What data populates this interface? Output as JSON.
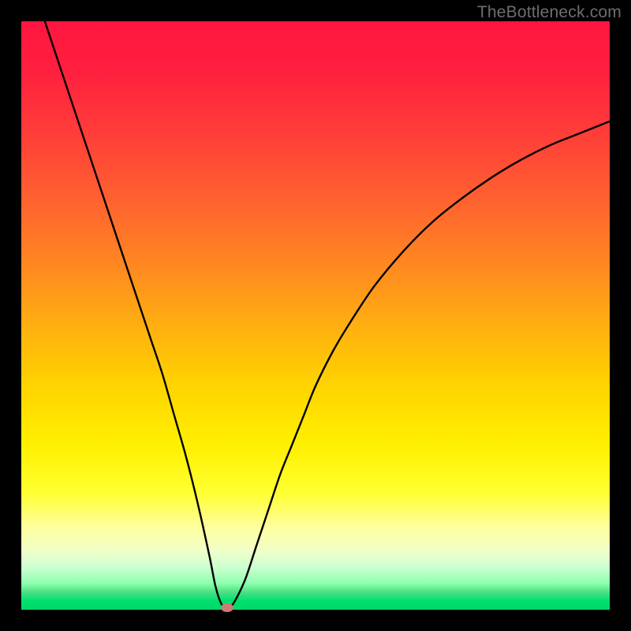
{
  "watermark": "TheBottleneck.com",
  "chart_data": {
    "type": "line",
    "title": "",
    "xlabel": "",
    "ylabel": "",
    "xlim": [
      0,
      100
    ],
    "ylim": [
      0,
      100
    ],
    "series": [
      {
        "name": "bottleneck-curve",
        "x": [
          4,
          6,
          8,
          10,
          12,
          14,
          16,
          18,
          20,
          22,
          24,
          26,
          28,
          30,
          32,
          33,
          34,
          35,
          36,
          38,
          40,
          42,
          44,
          46,
          48,
          50,
          53,
          56,
          60,
          65,
          70,
          75,
          80,
          85,
          90,
          95,
          100
        ],
        "y": [
          100,
          94,
          88,
          82,
          76,
          70,
          64,
          58,
          52,
          46,
          40,
          33,
          26,
          18,
          9,
          4,
          1,
          0.4,
          1,
          5,
          11,
          17,
          23,
          28,
          33,
          38,
          44,
          49,
          55,
          61,
          66,
          70,
          73.5,
          76.5,
          79,
          81,
          83
        ]
      }
    ],
    "marker": {
      "x": 35,
      "y": 0.4
    },
    "background": "heat-gradient"
  }
}
